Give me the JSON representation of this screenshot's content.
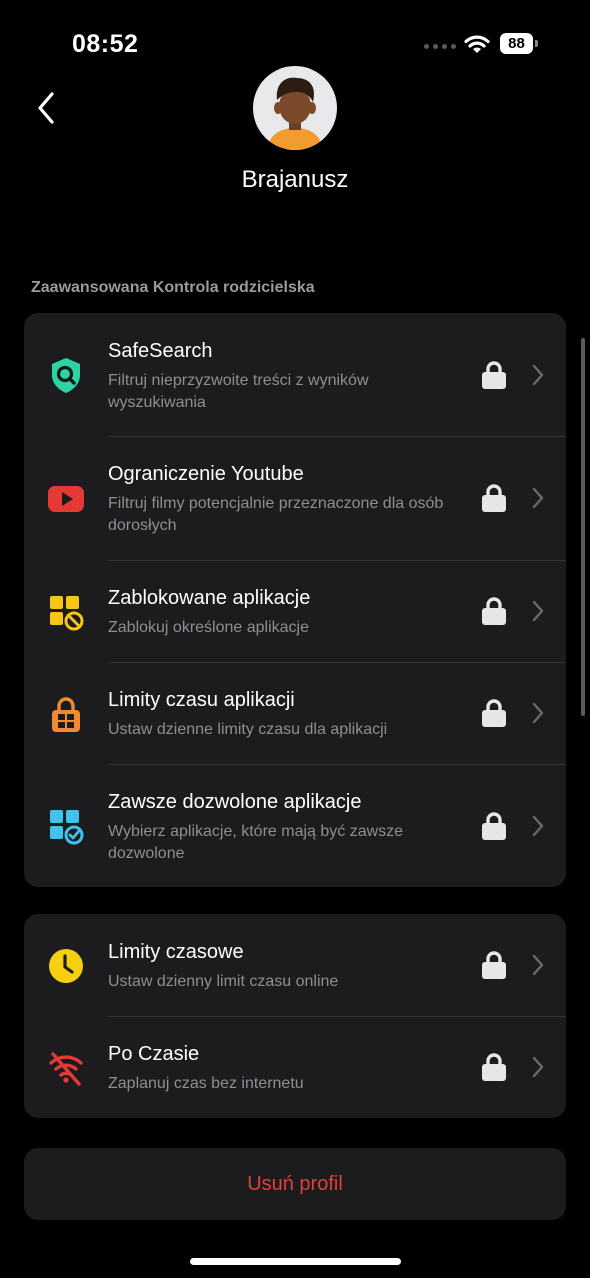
{
  "status_bar": {
    "time": "08:52",
    "battery": "88"
  },
  "header": {
    "back_label": "back",
    "profile_name": "Brajanusz"
  },
  "section_title": "Zaawansowana Kontrola rodzicielska",
  "advanced": [
    {
      "title": "SafeSearch",
      "subtitle": "Filtruj nieprzyzwoite treści z wyników wyszukiwania",
      "icon": "shield-search-icon",
      "color": "#2ed3a5"
    },
    {
      "title": "Ograniczenie Youtube",
      "subtitle": "Filtruj filmy potencjalnie przeznaczone dla osób dorosłych",
      "icon": "youtube-icon",
      "color": "#e53935"
    },
    {
      "title": "Zablokowane aplikacje",
      "subtitle": "Zablokuj określone aplikacje",
      "icon": "blocked-apps-icon",
      "color": "#f5c518"
    },
    {
      "title": "Limity czasu aplikacji",
      "subtitle": "Ustaw dzienne limity czasu dla aplikacji",
      "icon": "app-lock-icon",
      "color": "#f08a32"
    },
    {
      "title": "Zawsze dozwolone aplikacje",
      "subtitle": "Wybierz aplikacje, które mają być zawsze dozwolone",
      "icon": "allowed-apps-icon",
      "color": "#3ec3ea"
    }
  ],
  "time": [
    {
      "title": "Limity czasowe",
      "subtitle": "Ustaw dzienny limit czasu online",
      "icon": "clock-icon",
      "color": "#f5d00f"
    },
    {
      "title": "Po Czasie",
      "subtitle": "Zaplanuj czas bez internetu",
      "icon": "wifi-off-icon",
      "color": "#e53935"
    }
  ],
  "delete_label": "Usuń profil"
}
